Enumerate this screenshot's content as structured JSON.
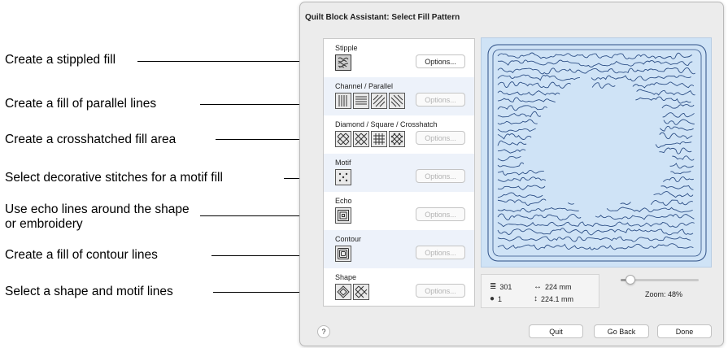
{
  "callouts": [
    "Create a stippled fill",
    "Create a fill of parallel lines",
    "Create a crosshatched fill area",
    "Select decorative stitches for a motif fill",
    "Use echo lines around the shape or embroidery",
    "Create a fill of contour lines",
    "Select a shape and motif lines"
  ],
  "dialog": {
    "title": "Quilt Block Assistant: Select Fill Pattern",
    "groups": [
      {
        "label": "Stipple",
        "options_label": "Options...",
        "options_enabled": true
      },
      {
        "label": "Channel / Parallel",
        "options_label": "Options...",
        "options_enabled": false
      },
      {
        "label": "Diamond / Square / Crosshatch",
        "options_label": "Options...",
        "options_enabled": false
      },
      {
        "label": "Motif",
        "options_label": "Options...",
        "options_enabled": false
      },
      {
        "label": "Echo",
        "options_label": "Options...",
        "options_enabled": false
      },
      {
        "label": "Contour",
        "options_label": "Options...",
        "options_enabled": false
      },
      {
        "label": "Shape",
        "options_label": "Options...",
        "options_enabled": false
      }
    ],
    "stats": {
      "stitches": "301",
      "colors": "1",
      "width": "224 mm",
      "height": "224.1 mm"
    },
    "zoom": {
      "label": "Zoom: 48%",
      "level_percent": 48
    },
    "buttons": {
      "help": "?",
      "quit": "Quit",
      "go_back": "Go Back",
      "done": "Done"
    }
  },
  "colors": {
    "preview_bg": "#cfe3f6",
    "stitch_line": "#2d4f86",
    "dialog_bg": "#ececec"
  },
  "icons": [
    "stipple-icon",
    "vertical-lines-icon",
    "horizontal-lines-icon",
    "diagonal-lines-icon",
    "diamond-icon",
    "square-grid-icon",
    "motif-icon",
    "echo-icon",
    "contour-icon",
    "shape-icon"
  ]
}
